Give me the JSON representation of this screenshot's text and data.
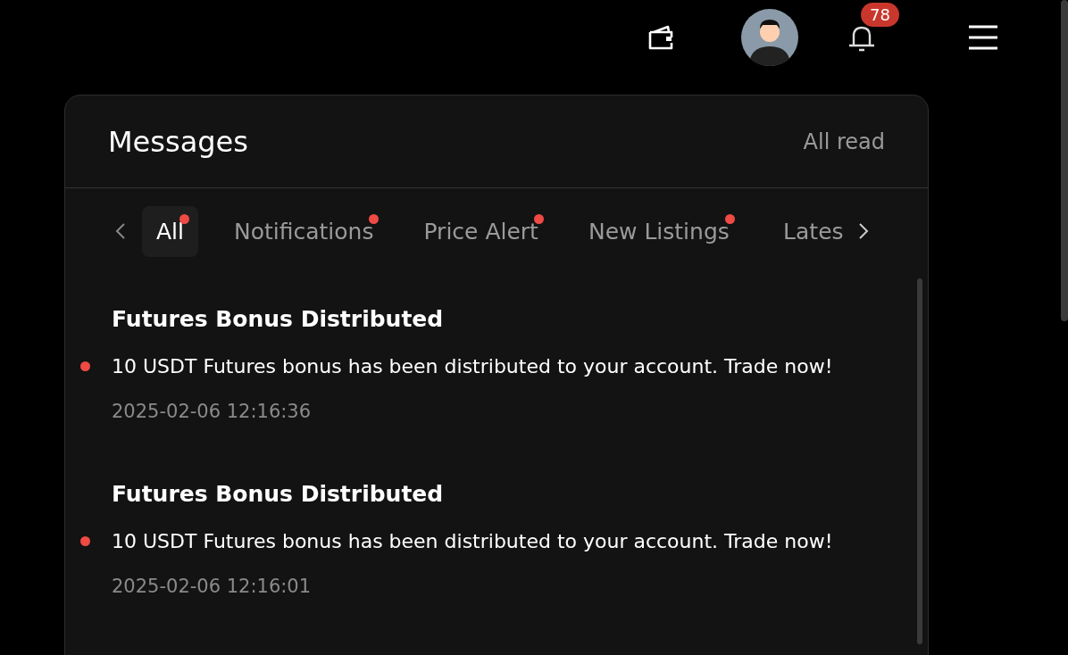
{
  "header": {
    "notification_count": "78"
  },
  "panel": {
    "title": "Messages",
    "action": "All read"
  },
  "tabs": [
    {
      "label": "All",
      "selected": true,
      "unread": true
    },
    {
      "label": "Notifications",
      "selected": false,
      "unread": true
    },
    {
      "label": "Price Alert",
      "selected": false,
      "unread": true
    },
    {
      "label": "New Listings",
      "selected": false,
      "unread": true
    },
    {
      "label": "Lates",
      "selected": false,
      "unread": false
    }
  ],
  "messages": [
    {
      "title": "Futures Bonus Distributed",
      "body": "10 USDT Futures bonus has been distributed to your account. Trade now!",
      "time": "2025-02-06 12:16:36",
      "unread": true
    },
    {
      "title": "Futures Bonus Distributed",
      "body": "10 USDT Futures bonus has been distributed to your account. Trade now!",
      "time": "2025-02-06 12:16:01",
      "unread": true
    }
  ]
}
